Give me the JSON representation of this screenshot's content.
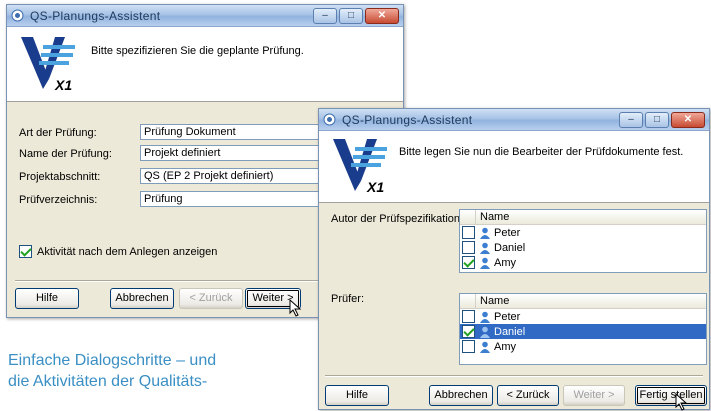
{
  "caption": {
    "line1": "Einfache Dialogschritte – und",
    "line2": "die Aktivitäten der Qualitäts-"
  },
  "window1": {
    "title": "QS-Planungs-Assistent",
    "header_text": "Bitte spezifizieren Sie die geplante Prüfung.",
    "logo_label": "X1",
    "fields": [
      {
        "label": "Art der Prüfung:",
        "value": "Prüfung Dokument"
      },
      {
        "label": "Name der Prüfung:",
        "value": "Projekt definiert"
      },
      {
        "label": "Projektabschnitt:",
        "value": "QS (EP 2 Projekt definiert)"
      },
      {
        "label": "Prüfverzeichnis:",
        "value": "Prüfung"
      }
    ],
    "checkbox_label": "Aktivität nach dem Anlegen anzeigen",
    "checkbox_checked": true,
    "buttons": {
      "help": "Hilfe",
      "cancel": "Abbrechen",
      "back": "< Zurück",
      "next": "Weiter >"
    }
  },
  "window2": {
    "title": "QS-Planungs-Assistent",
    "header_text": "Bitte legen Sie nun die Bearbeiter der Prüfdokumente fest.",
    "logo_label": "X1",
    "author_label": "Autor der Prüfspezifikation:",
    "reviewer_label": "Prüfer:",
    "column_name": "Name",
    "authors": [
      {
        "name": "Peter",
        "checked": false
      },
      {
        "name": "Daniel",
        "checked": false
      },
      {
        "name": "Amy",
        "checked": true
      }
    ],
    "reviewers": [
      {
        "name": "Peter",
        "checked": false
      },
      {
        "name": "Daniel",
        "checked": true
      },
      {
        "name": "Amy",
        "checked": false
      }
    ],
    "buttons": {
      "help": "Hilfe",
      "cancel": "Abbrechen",
      "back": "< Zurück",
      "next": "Weiter >",
      "finish": "Fertig stellen"
    }
  },
  "titlebar_buttons": {
    "minimize": "–",
    "maximize": "□",
    "close": "✕"
  }
}
